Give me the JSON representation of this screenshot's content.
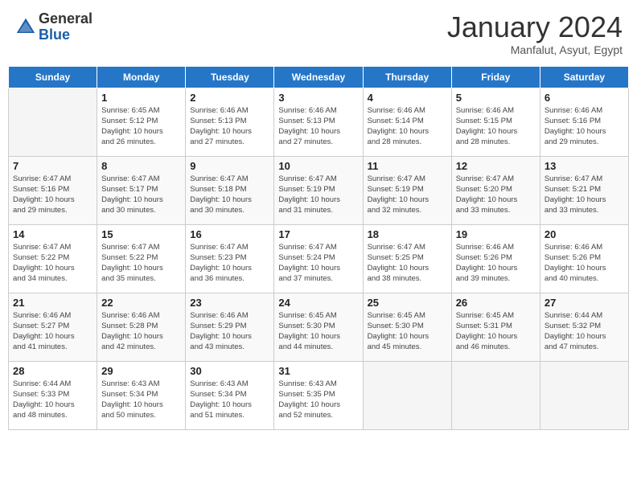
{
  "header": {
    "logo_general": "General",
    "logo_blue": "Blue",
    "month_year": "January 2024",
    "location": "Manfalut, Asyut, Egypt"
  },
  "days_of_week": [
    "Sunday",
    "Monday",
    "Tuesday",
    "Wednesday",
    "Thursday",
    "Friday",
    "Saturday"
  ],
  "weeks": [
    [
      {
        "day": "",
        "info": ""
      },
      {
        "day": "1",
        "info": "Sunrise: 6:45 AM\nSunset: 5:12 PM\nDaylight: 10 hours\nand 26 minutes."
      },
      {
        "day": "2",
        "info": "Sunrise: 6:46 AM\nSunset: 5:13 PM\nDaylight: 10 hours\nand 27 minutes."
      },
      {
        "day": "3",
        "info": "Sunrise: 6:46 AM\nSunset: 5:13 PM\nDaylight: 10 hours\nand 27 minutes."
      },
      {
        "day": "4",
        "info": "Sunrise: 6:46 AM\nSunset: 5:14 PM\nDaylight: 10 hours\nand 28 minutes."
      },
      {
        "day": "5",
        "info": "Sunrise: 6:46 AM\nSunset: 5:15 PM\nDaylight: 10 hours\nand 28 minutes."
      },
      {
        "day": "6",
        "info": "Sunrise: 6:46 AM\nSunset: 5:16 PM\nDaylight: 10 hours\nand 29 minutes."
      }
    ],
    [
      {
        "day": "7",
        "info": "Sunrise: 6:47 AM\nSunset: 5:16 PM\nDaylight: 10 hours\nand 29 minutes."
      },
      {
        "day": "8",
        "info": "Sunrise: 6:47 AM\nSunset: 5:17 PM\nDaylight: 10 hours\nand 30 minutes."
      },
      {
        "day": "9",
        "info": "Sunrise: 6:47 AM\nSunset: 5:18 PM\nDaylight: 10 hours\nand 30 minutes."
      },
      {
        "day": "10",
        "info": "Sunrise: 6:47 AM\nSunset: 5:19 PM\nDaylight: 10 hours\nand 31 minutes."
      },
      {
        "day": "11",
        "info": "Sunrise: 6:47 AM\nSunset: 5:19 PM\nDaylight: 10 hours\nand 32 minutes."
      },
      {
        "day": "12",
        "info": "Sunrise: 6:47 AM\nSunset: 5:20 PM\nDaylight: 10 hours\nand 33 minutes."
      },
      {
        "day": "13",
        "info": "Sunrise: 6:47 AM\nSunset: 5:21 PM\nDaylight: 10 hours\nand 33 minutes."
      }
    ],
    [
      {
        "day": "14",
        "info": "Sunrise: 6:47 AM\nSunset: 5:22 PM\nDaylight: 10 hours\nand 34 minutes."
      },
      {
        "day": "15",
        "info": "Sunrise: 6:47 AM\nSunset: 5:22 PM\nDaylight: 10 hours\nand 35 minutes."
      },
      {
        "day": "16",
        "info": "Sunrise: 6:47 AM\nSunset: 5:23 PM\nDaylight: 10 hours\nand 36 minutes."
      },
      {
        "day": "17",
        "info": "Sunrise: 6:47 AM\nSunset: 5:24 PM\nDaylight: 10 hours\nand 37 minutes."
      },
      {
        "day": "18",
        "info": "Sunrise: 6:47 AM\nSunset: 5:25 PM\nDaylight: 10 hours\nand 38 minutes."
      },
      {
        "day": "19",
        "info": "Sunrise: 6:46 AM\nSunset: 5:26 PM\nDaylight: 10 hours\nand 39 minutes."
      },
      {
        "day": "20",
        "info": "Sunrise: 6:46 AM\nSunset: 5:26 PM\nDaylight: 10 hours\nand 40 minutes."
      }
    ],
    [
      {
        "day": "21",
        "info": "Sunrise: 6:46 AM\nSunset: 5:27 PM\nDaylight: 10 hours\nand 41 minutes."
      },
      {
        "day": "22",
        "info": "Sunrise: 6:46 AM\nSunset: 5:28 PM\nDaylight: 10 hours\nand 42 minutes."
      },
      {
        "day": "23",
        "info": "Sunrise: 6:46 AM\nSunset: 5:29 PM\nDaylight: 10 hours\nand 43 minutes."
      },
      {
        "day": "24",
        "info": "Sunrise: 6:45 AM\nSunset: 5:30 PM\nDaylight: 10 hours\nand 44 minutes."
      },
      {
        "day": "25",
        "info": "Sunrise: 6:45 AM\nSunset: 5:30 PM\nDaylight: 10 hours\nand 45 minutes."
      },
      {
        "day": "26",
        "info": "Sunrise: 6:45 AM\nSunset: 5:31 PM\nDaylight: 10 hours\nand 46 minutes."
      },
      {
        "day": "27",
        "info": "Sunrise: 6:44 AM\nSunset: 5:32 PM\nDaylight: 10 hours\nand 47 minutes."
      }
    ],
    [
      {
        "day": "28",
        "info": "Sunrise: 6:44 AM\nSunset: 5:33 PM\nDaylight: 10 hours\nand 48 minutes."
      },
      {
        "day": "29",
        "info": "Sunrise: 6:43 AM\nSunset: 5:34 PM\nDaylight: 10 hours\nand 50 minutes."
      },
      {
        "day": "30",
        "info": "Sunrise: 6:43 AM\nSunset: 5:34 PM\nDaylight: 10 hours\nand 51 minutes."
      },
      {
        "day": "31",
        "info": "Sunrise: 6:43 AM\nSunset: 5:35 PM\nDaylight: 10 hours\nand 52 minutes."
      },
      {
        "day": "",
        "info": ""
      },
      {
        "day": "",
        "info": ""
      },
      {
        "day": "",
        "info": ""
      }
    ]
  ]
}
